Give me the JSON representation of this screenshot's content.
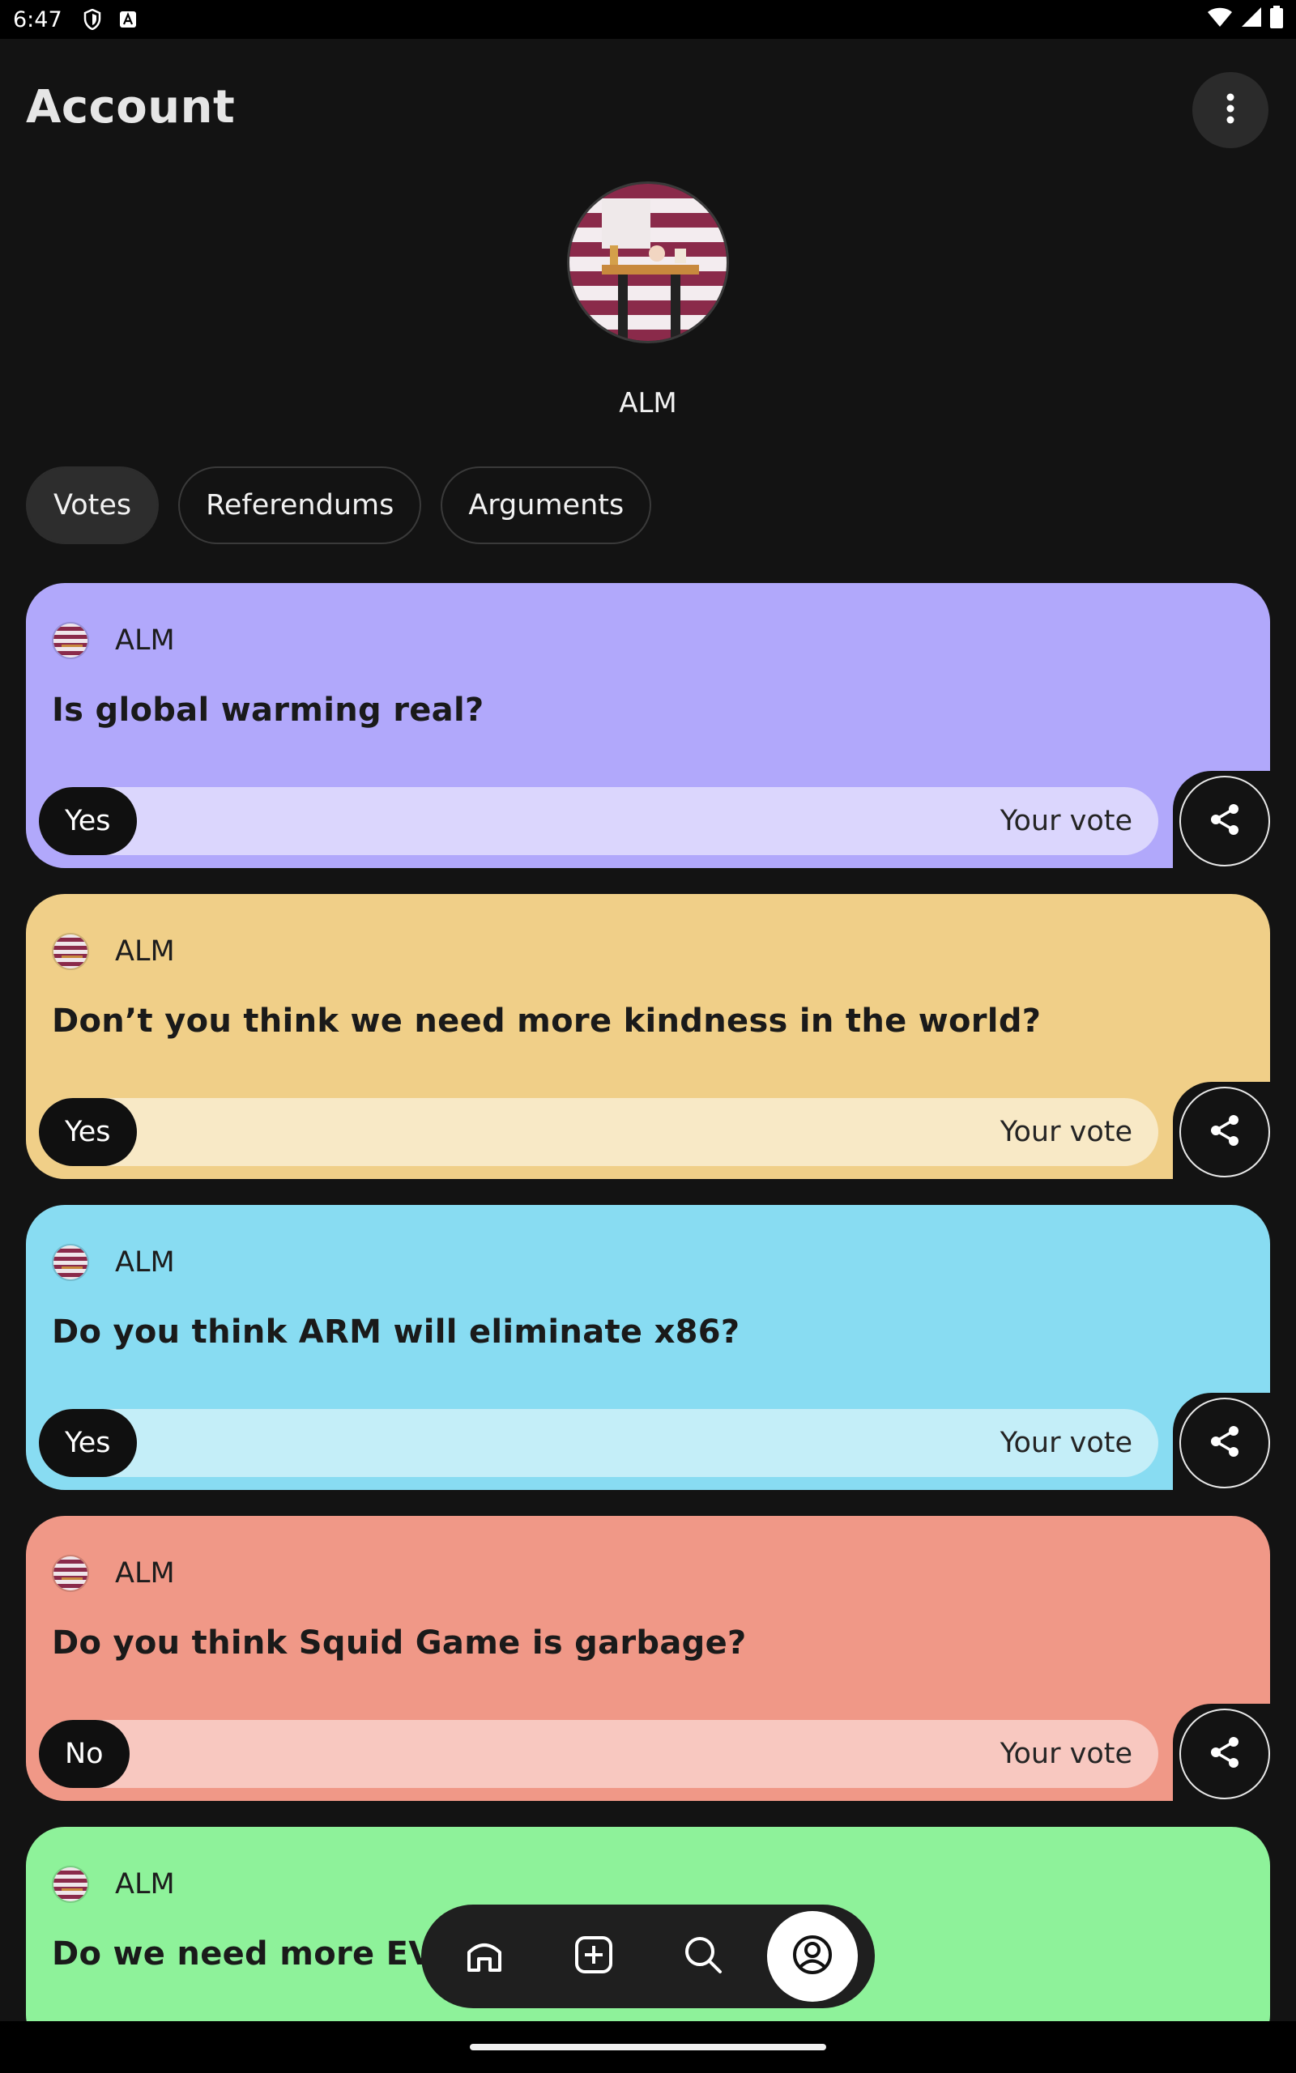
{
  "status_bar": {
    "time": "6:47"
  },
  "header": {
    "title": "Account"
  },
  "profile": {
    "username": "ALM"
  },
  "tabs": [
    {
      "label": "Votes",
      "active": true
    },
    {
      "label": "Referendums",
      "active": false
    },
    {
      "label": "Arguments",
      "active": false
    }
  ],
  "cards": [
    {
      "author": "ALM",
      "question": "Is global warming real?",
      "vote": "Yes",
      "vote_label": "Your vote",
      "color": "#b1a8fb",
      "bar_color": "#dbd6fd"
    },
    {
      "author": "ALM",
      "question": "Don’t you think we need more kindness in the world?",
      "vote": "Yes",
      "vote_label": "Your vote",
      "color": "#f0cf88",
      "bar_color": "#f8e9c6"
    },
    {
      "author": "ALM",
      "question": "Do you think ARM will eliminate x86?",
      "vote": "Yes",
      "vote_label": "Your vote",
      "color": "#88dcf2",
      "bar_color": "#c4eef8"
    },
    {
      "author": "ALM",
      "question": "Do you think Squid Game is garbage?",
      "vote": "No",
      "vote_label": "Your vote",
      "color": "#f09887",
      "bar_color": "#f8c8c0"
    },
    {
      "author": "ALM",
      "question": "Do we need more EVs?",
      "color": "#8ef29a"
    }
  ],
  "bottom_nav": {
    "items": [
      {
        "icon": "home-icon"
      },
      {
        "icon": "add-icon"
      },
      {
        "icon": "search-icon"
      },
      {
        "icon": "account-icon",
        "active": true
      }
    ]
  }
}
